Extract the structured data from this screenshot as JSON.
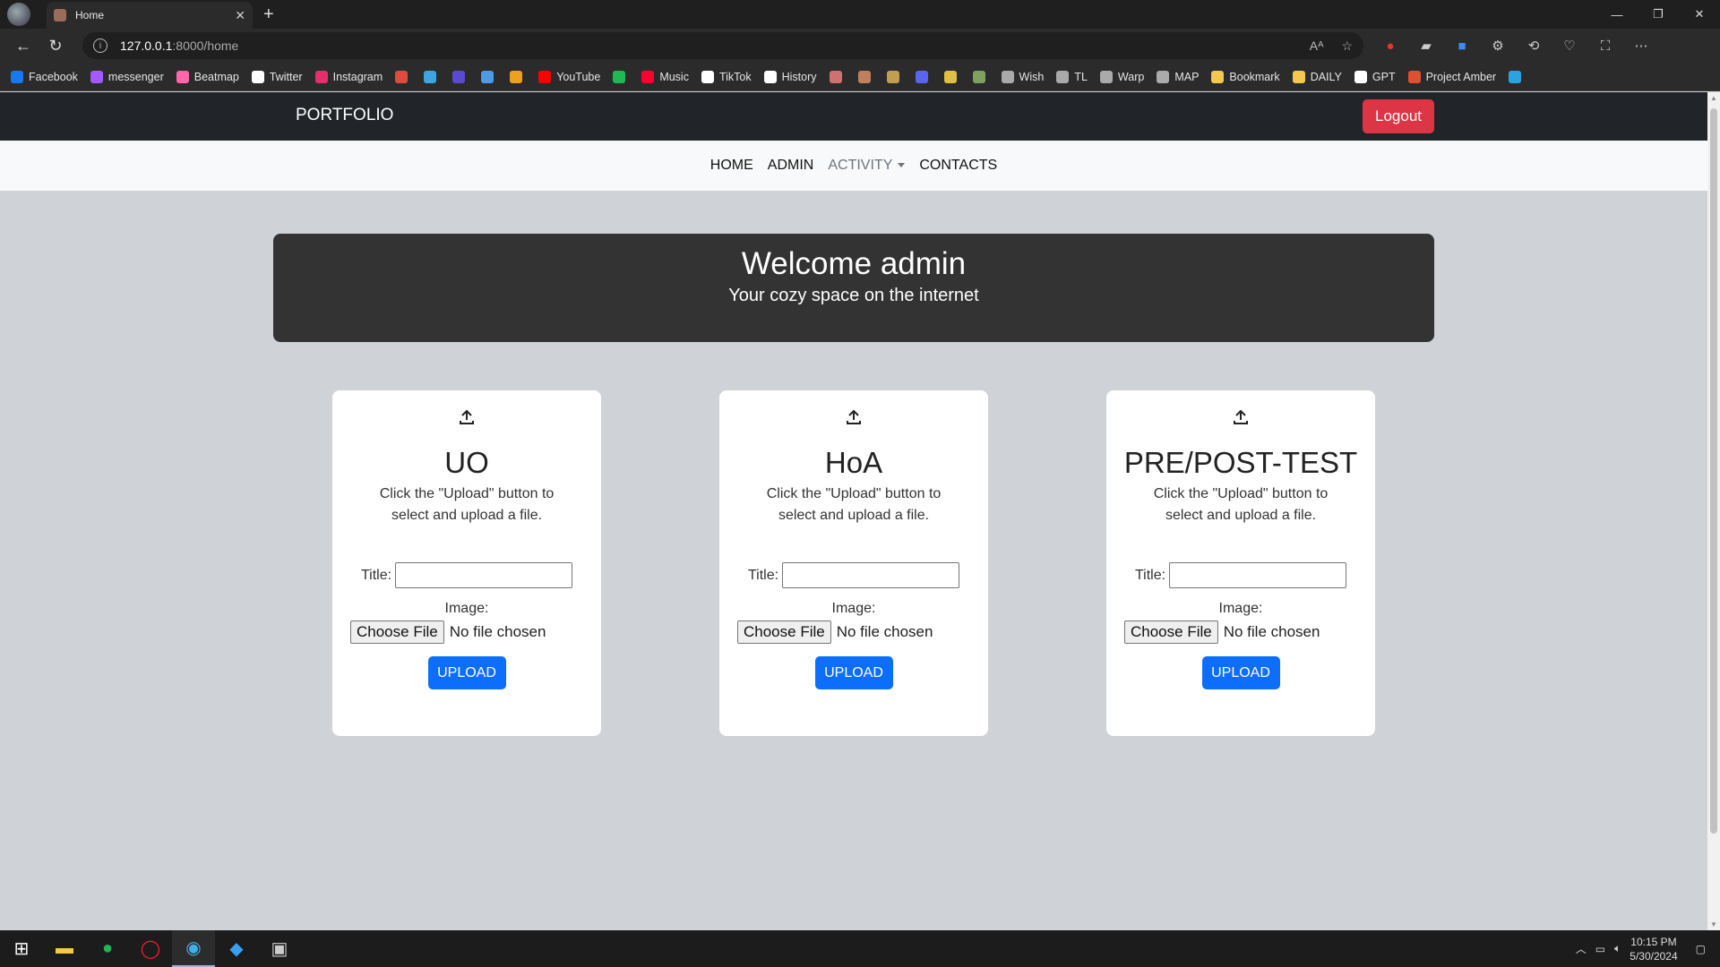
{
  "browser": {
    "tab_title": "Home",
    "url_host": "127.0.0.1",
    "url_path": ":8000/home",
    "new_tab": "+",
    "bookmarks": [
      {
        "label": "Facebook",
        "color": "#1877f2"
      },
      {
        "label": "messenger",
        "color": "#a259ff"
      },
      {
        "label": "Beatmap",
        "color": "#ff66aa"
      },
      {
        "label": "Twitter",
        "color": "#ffffff"
      },
      {
        "label": "Instagram",
        "color": "#e1306c"
      },
      {
        "label": "",
        "color": "#e04b3f"
      },
      {
        "label": "",
        "color": "#3fa4e0"
      },
      {
        "label": "",
        "color": "#5b4ad1"
      },
      {
        "label": "",
        "color": "#4c9be8"
      },
      {
        "label": "",
        "color": "#f0a020"
      },
      {
        "label": "YouTube",
        "color": "#ff0000"
      },
      {
        "label": "",
        "color": "#1db954"
      },
      {
        "label": "Music",
        "color": "#ff0033"
      },
      {
        "label": "TikTok",
        "color": "#ffffff"
      },
      {
        "label": "History",
        "color": "#ffffff"
      },
      {
        "label": "",
        "color": "#d07070"
      },
      {
        "label": "",
        "color": "#c08060"
      },
      {
        "label": "",
        "color": "#c0a050"
      },
      {
        "label": "",
        "color": "#5865f2"
      },
      {
        "label": "",
        "color": "#e0c040"
      },
      {
        "label": "",
        "color": "#80a060"
      },
      {
        "label": "Wish",
        "color": "#aaaaaa"
      },
      {
        "label": "TL",
        "color": "#aaaaaa"
      },
      {
        "label": "Warp",
        "color": "#aaaaaa"
      },
      {
        "label": "MAP",
        "color": "#aaaaaa"
      },
      {
        "label": "Bookmark",
        "color": "#f2c94c"
      },
      {
        "label": "DAILY",
        "color": "#f2c94c"
      },
      {
        "label": "GPT",
        "color": "#ffffff"
      },
      {
        "label": "Project Amber",
        "color": "#e05030"
      },
      {
        "label": "",
        "color": "#2aa3e0"
      }
    ]
  },
  "navbar": {
    "brand": "PORTFOLIO",
    "logout_label": "Logout"
  },
  "menu": {
    "home": "HOME",
    "admin": "ADMIN",
    "activity": "ACTIVITY",
    "contacts": "CONTACTS"
  },
  "hero": {
    "title": "Welcome admin",
    "subtitle": "Your cozy space on the internet"
  },
  "cards": [
    {
      "title": "UO",
      "desc": "Click the \"Upload\" button to select and upload a file.",
      "title_label": "Title:",
      "image_label": "Image:",
      "file_button": "Choose File",
      "file_status": "No file chosen",
      "upload_label": "UPLOAD"
    },
    {
      "title": "HoA",
      "desc": "Click the \"Upload\" button to select and upload a file.",
      "title_label": "Title:",
      "image_label": "Image:",
      "file_button": "Choose File",
      "file_status": "No file chosen",
      "upload_label": "UPLOAD"
    },
    {
      "title": "PRE/POST-TEST",
      "desc": "Click the \"Upload\" button to select and upload a file.",
      "title_label": "Title:",
      "image_label": "Image:",
      "file_button": "Choose File",
      "file_status": "No file chosen",
      "upload_label": "UPLOAD"
    }
  ],
  "taskbar": {
    "time": "10:15 PM",
    "date": "5/30/2024"
  },
  "colors": {
    "accent": "#0d6efd",
    "danger": "#dc3545",
    "navbar": "#212529"
  }
}
